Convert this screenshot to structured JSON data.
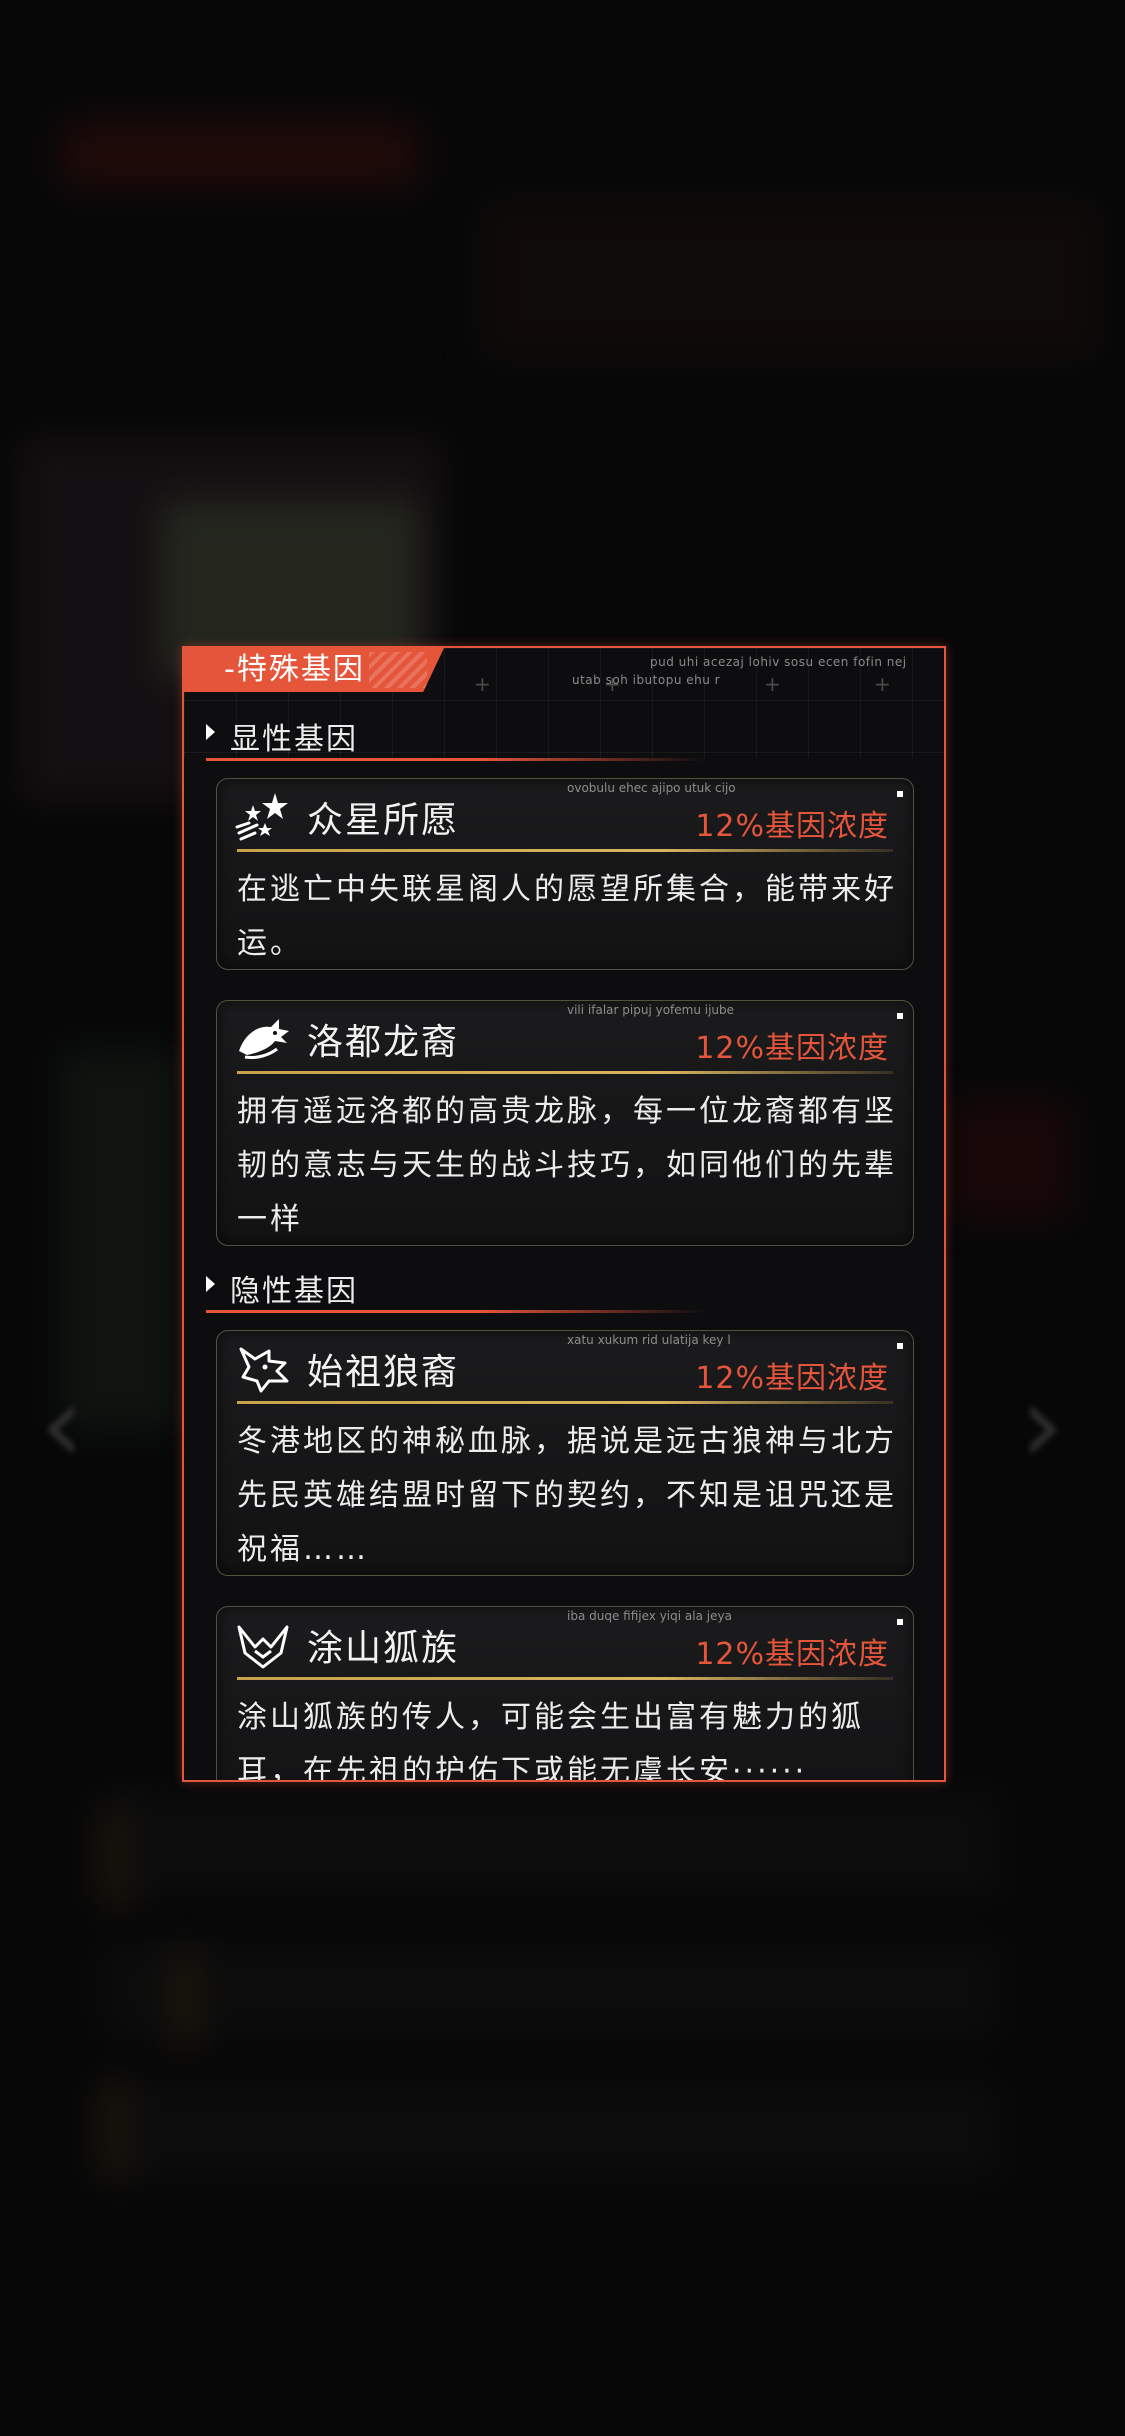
{
  "panel": {
    "title": "-特殊基因",
    "deco_line_1": "pud uhi acezaj lohiv sosu ecen fofin nej",
    "deco_line_2": "utab soh ibutopu ehu r"
  },
  "sections": [
    {
      "label": "显性基因",
      "genes": [
        {
          "icon": "stars-icon",
          "name": "众星所愿",
          "concentration": "12%基因浓度",
          "cap_text": "ovobulu ehec ajipo utuk cijo",
          "description": "在逃亡中失联星阁人的愿望所集合，能带来好运。"
        },
        {
          "icon": "dragon-icon",
          "name": "洛都龙裔",
          "concentration": "12%基因浓度",
          "cap_text": "vili ifalar pipuj yofemu ijube",
          "description": "拥有遥远洛都的高贵龙脉，每一位龙裔都有坚韧的意志与天生的战斗技巧，如同他们的先辈一样"
        }
      ]
    },
    {
      "label": "隐性基因",
      "genes": [
        {
          "icon": "wolf-icon",
          "name": "始祖狼裔",
          "concentration": "12%基因浓度",
          "cap_text": "xatu xukum rid ulatija key l",
          "description": "冬港地区的神秘血脉，据说是远古狼神与北方先民英雄结盟时留下的契约，不知是诅咒还是祝福……"
        },
        {
          "icon": "fox-icon",
          "name": "涂山狐族",
          "concentration": "12%基因浓度",
          "cap_text": "iba duqe fifijex yiqi ala jeya",
          "description": "涂山狐族的传人，可能会生出富有魅力的狐耳，在先祖的护佑下或能无虞长安······"
        }
      ]
    }
  ],
  "colors": {
    "accent": "#e4553a",
    "gold_line": "#c7a24a",
    "background": "#0d0d0f"
  }
}
